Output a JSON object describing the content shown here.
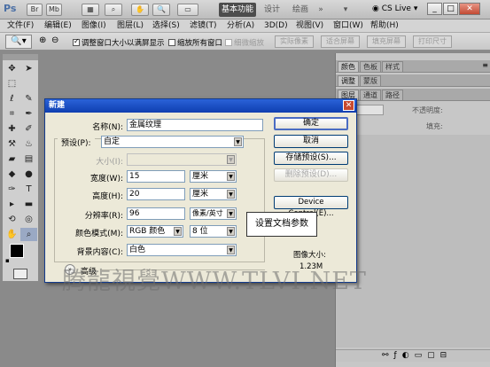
{
  "titlebar": {
    "logo": "Ps",
    "workspaces": [
      "基本功能",
      "设计",
      "绘画"
    ],
    "more": "»",
    "cslive": "CS Live"
  },
  "menu": [
    "文件(F)",
    "编辑(E)",
    "图像(I)",
    "图层(L)",
    "选择(S)",
    "滤镜(T)",
    "分析(A)",
    "3D(D)",
    "视图(V)",
    "窗口(W)",
    "帮助(H)"
  ],
  "options": {
    "resize_windows": "调整窗口大小以满屏显示",
    "zoom_all": "缩放所有窗口",
    "scrubby": "细微缩放",
    "actual_pixels": "实际像素",
    "fit_screen": "适合屏幕",
    "fill_screen": "填充屏幕",
    "print_size": "打印尺寸"
  },
  "panels": {
    "row1": [
      "颜色",
      "色板",
      "样式"
    ],
    "row2": [
      "调整",
      "蒙版"
    ],
    "row3": [
      "图层",
      "通道",
      "路径"
    ],
    "opacity_label": "不透明度:",
    "fill_label": "填充:"
  },
  "dialog": {
    "title": "新建",
    "name_label": "名称(N):",
    "name_value": "金属纹理",
    "preset_label": "预设(P):",
    "preset_value": "自定",
    "size_label": "大小(I):",
    "width_label": "宽度(W):",
    "width_value": "15",
    "width_unit": "厘米",
    "height_label": "高度(H):",
    "height_value": "20",
    "height_unit": "厘米",
    "resolution_label": "分辨率(R):",
    "resolution_value": "96",
    "resolution_unit": "像素/英寸",
    "colormode_label": "颜色模式(M):",
    "colormode_value": "RGB 颜色",
    "bitdepth_value": "8 位",
    "background_label": "背景内容(C):",
    "background_value": "白色",
    "advanced_label": "高级",
    "ok": "确定",
    "cancel": "取消",
    "save_preset": "存储预设(S)...",
    "delete_preset": "删除预设(D)...",
    "device_central": "Device Central(E)...",
    "image_size_label": "图像大小:",
    "image_size_value": "1.23M"
  },
  "callout": "设置文档参数",
  "watermark": "腾龍視覺WWW.TLVI.NET",
  "colors": {
    "title_blue": "#0f3fb0",
    "canvas_gray": "#8a8a8a"
  }
}
